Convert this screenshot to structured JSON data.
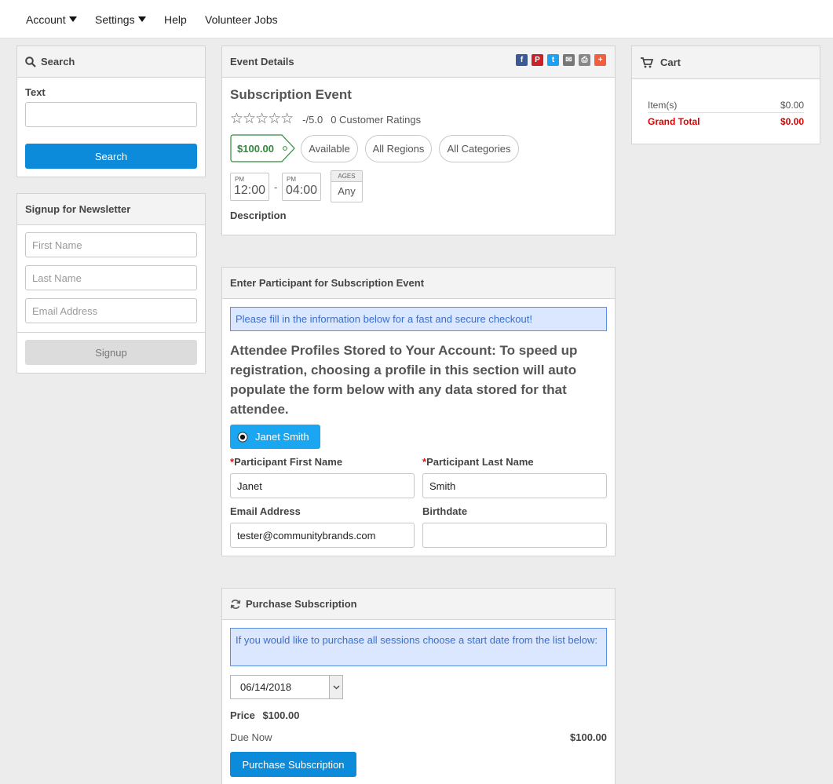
{
  "nav": {
    "account": "Account",
    "settings": "Settings",
    "help": "Help",
    "volunteer": "Volunteer Jobs"
  },
  "search_panel": {
    "title": "Search",
    "text_label": "Text",
    "text_value": "",
    "button": "Search"
  },
  "newsletter": {
    "title": "Signup for Newsletter",
    "first_name_ph": "First Name",
    "last_name_ph": "Last Name",
    "email_ph": "Email Address",
    "button": "Signup"
  },
  "event": {
    "header": "Event Details",
    "name": "Subscription Event",
    "rating": "-/5.0",
    "ratings_count": "0 Customer Ratings",
    "stars_filled": 0,
    "price": "$100.00",
    "availability": "Available",
    "regions": "All Regions",
    "categories": "All Categories",
    "start_ampm": "PM",
    "start_time": "12:00",
    "dash": "-",
    "end_ampm": "PM",
    "end_time": "04:00",
    "ages_label": "AGES",
    "ages_value": "Any",
    "description_label": "Description",
    "social_icons": [
      "facebook-icon",
      "pinterest-icon",
      "twitter-icon",
      "email-icon",
      "print-icon",
      "share-plus-icon"
    ]
  },
  "participant": {
    "header": "Enter Participant for Subscription Event",
    "notice": "Please fill in the information below for a fast and secure checkout!",
    "profiles_text": "Attendee Profiles Stored to Your Account: To speed up registration, choosing a profile in this section will auto populate the form below with any data stored for that attendee.",
    "profile_name": "Janet Smith",
    "first_name_label": "Participant First Name",
    "last_name_label": "Participant Last Name",
    "required_mark": "*",
    "first_name": "Janet",
    "last_name": "Smith",
    "email_label": "Email Address",
    "email": "tester@communitybrands.com",
    "birthdate_label": "Birthdate",
    "birthdate": ""
  },
  "subscription": {
    "header": "Purchase Subscription",
    "notice": "If you would like to purchase all sessions choose a start date from the list below:",
    "start_date": "06/14/2018",
    "price_label": "Price",
    "price_value": "$100.00",
    "due_label": "Due Now",
    "due_value": "$100.00",
    "button": "Purchase Subscription"
  },
  "cart": {
    "title": "Cart",
    "items_label": "Item(s)",
    "items_value": "$0.00",
    "total_label": "Grand Total",
    "total_value": "$0.00"
  },
  "colors": {
    "accent": "#0b8bd9",
    "profile_btn": "#1aa6f0",
    "price_green": "#2e8b3a",
    "grand_total_red": "#e00000"
  }
}
